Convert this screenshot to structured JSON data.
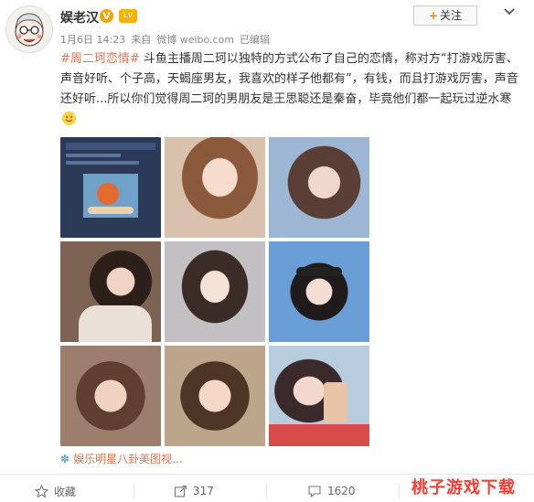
{
  "header": {
    "username": "娱老汉",
    "verified_badge": "V",
    "level_badge": "Lv",
    "timestamp": "1月6日 14:23",
    "source_prefix": "来自",
    "source": "微博 weibo.com",
    "edited": "已编辑",
    "follow_label": "关注",
    "follow_icon": "plus-icon",
    "more_icon": "chevron-down-icon"
  },
  "post": {
    "hashtag": "#周二珂恋情#",
    "text": " 斗鱼主播周二珂以独特的方式公布了自己的恋情，称对方“打游戏厉害、声音好听、个子高，天蝎座男友，我喜欢的样子他都有”，有钱，而且打游戏厉害，声音还好听...所以你们觉得周二珂的男朋友是王思聪还是秦奋，毕竟他们都一起玩过逆水寒",
    "emoji": "smile-emoji"
  },
  "photos": {
    "count": 9,
    "colors": [
      "#27344c",
      "#c9a48d",
      "#8aa7c9",
      "#6b5144",
      "#b9b6bb",
      "#5d8ec7",
      "#8e6f5d",
      "#b19a7b",
      "#a9c3d4"
    ]
  },
  "source_line": {
    "lead_icon": "flower-icon",
    "text": "娱乐明星八卦美图视..."
  },
  "actions": {
    "favorite_label": "收藏",
    "repost_count": "317",
    "comment_count": "1620",
    "like_count": ""
  },
  "watermark": "桃子游戏下载"
}
